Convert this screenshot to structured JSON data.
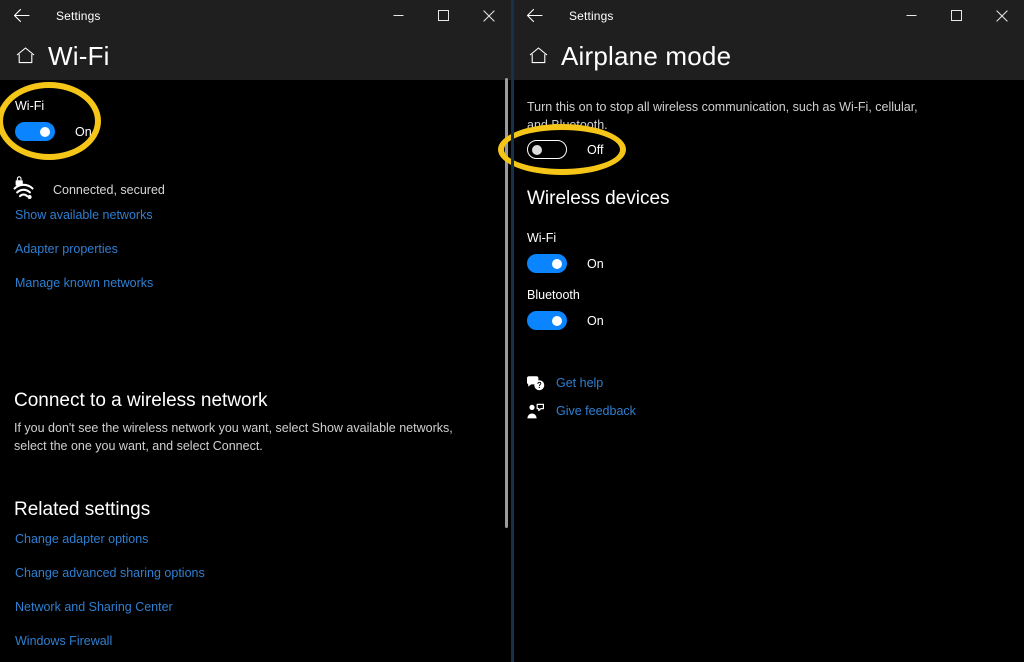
{
  "colors": {
    "accent_blue": "#0a84ff",
    "link_blue": "#2f7fd1",
    "highlight_yellow": "#f5c518",
    "header_bg": "#1f1f1f",
    "content_bg": "#000000"
  },
  "left_window": {
    "titlebar": {
      "back_label": "Back",
      "title": "Settings",
      "minimize_label": "Minimize",
      "maximize_label": "Maximize",
      "close_label": "Close"
    },
    "header": {
      "home_label": "Home",
      "page_title": "Wi-Fi"
    },
    "wifi_section": {
      "label": "Wi-Fi",
      "toggle_state": "On",
      "toggle_on": true
    },
    "status": {
      "text": "Connected, secured"
    },
    "links": [
      "Show available networks",
      "Adapter properties",
      "Manage known networks"
    ],
    "connect_section": {
      "heading": "Connect to a wireless network",
      "body": "If you don't see the wireless network you want, select Show available networks, select the one you want, and select Connect."
    },
    "related_section": {
      "heading": "Related settings",
      "links": [
        "Change adapter options",
        "Change advanced sharing options",
        "Network and Sharing Center",
        "Windows Firewall"
      ]
    }
  },
  "right_window": {
    "titlebar": {
      "back_label": "Back",
      "title": "Settings",
      "minimize_label": "Minimize",
      "maximize_label": "Maximize",
      "close_label": "Close"
    },
    "header": {
      "home_label": "Home",
      "page_title": "Airplane mode"
    },
    "description_line1": "Turn this on to stop all wireless communication, such as Wi-Fi, cellular,",
    "description_line2": "and Bluetooth.",
    "airplane_toggle": {
      "state": "Off",
      "toggle_on": false
    },
    "wireless_devices": {
      "heading": "Wireless devices",
      "items": [
        {
          "label": "Wi-Fi",
          "state": "On",
          "toggle_on": true
        },
        {
          "label": "Bluetooth",
          "state": "On",
          "toggle_on": true
        }
      ]
    },
    "help_links": [
      {
        "icon": "get-help-icon",
        "label": "Get help"
      },
      {
        "icon": "give-feedback-icon",
        "label": "Give feedback"
      }
    ]
  }
}
